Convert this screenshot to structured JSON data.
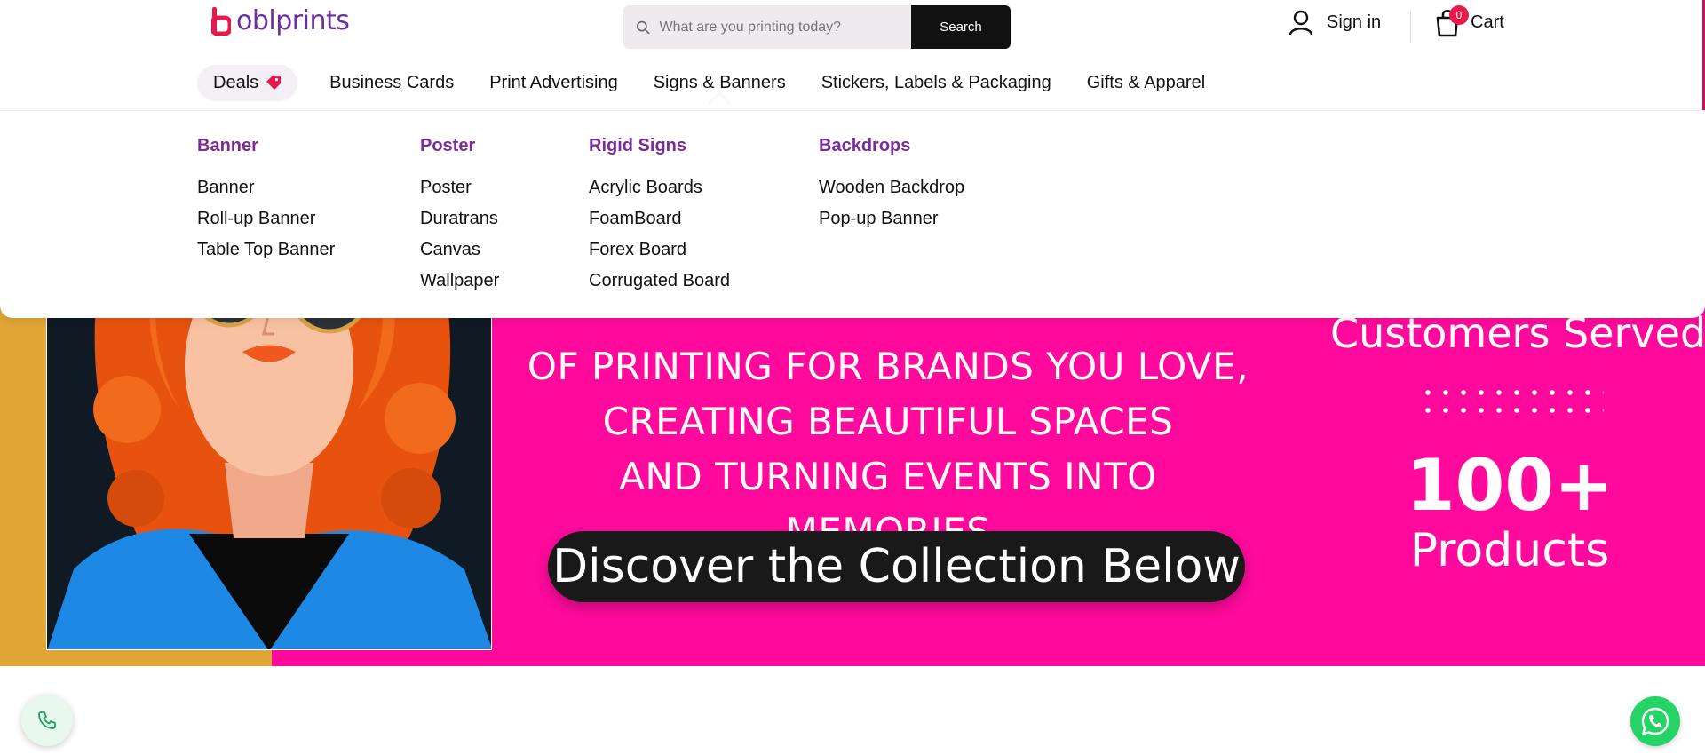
{
  "brand": {
    "logo_text": "oblprints",
    "accent": "#e8184d",
    "purple": "#6b2fa0"
  },
  "search": {
    "placeholder": "What are you printing today?",
    "button_label": "Search"
  },
  "account": {
    "signin_label": "Sign in"
  },
  "cart": {
    "label": "Cart",
    "count": "0"
  },
  "nav": {
    "items": [
      {
        "label": "Deals",
        "icon": "tag-icon"
      },
      {
        "label": "Business Cards"
      },
      {
        "label": "Print Advertising"
      },
      {
        "label": "Signs & Banners"
      },
      {
        "label": "Stickers, Labels & Packaging"
      },
      {
        "label": "Gifts & Apparel"
      }
    ],
    "active": "Signs & Banners"
  },
  "mega_menu": {
    "columns": [
      {
        "title": "Banner",
        "links": [
          "Banner",
          "Roll-up Banner",
          "Table Top Banner"
        ]
      },
      {
        "title": "Poster",
        "links": [
          "Poster",
          "Duratrans",
          "Canvas",
          "Wallpaper"
        ]
      },
      {
        "title": "Rigid Signs",
        "links": [
          "Acrylic Boards",
          "FoamBoard",
          "Forex Board",
          "Corrugated Board"
        ]
      },
      {
        "title": "Backdrops",
        "links": [
          "Wooden Backdrop",
          "Pop-up Banner"
        ]
      }
    ]
  },
  "hero": {
    "lines": [
      "OF PRINTING FOR BRANDS YOU LOVE,",
      "CREATING BEAUTIFUL SPACES",
      "AND TURNING EVENTS INTO MEMORIES"
    ],
    "cta_label": "Discover the Collection Below",
    "stat_customers_label": "Customers Served",
    "stat_number": "100+",
    "stat_products_label": "Products",
    "colors": {
      "pink": "#ff0a9c",
      "yellow": "#e1a534"
    }
  },
  "floating": {
    "call_icon": "phone-icon",
    "whatsapp_icon": "whatsapp-icon"
  }
}
